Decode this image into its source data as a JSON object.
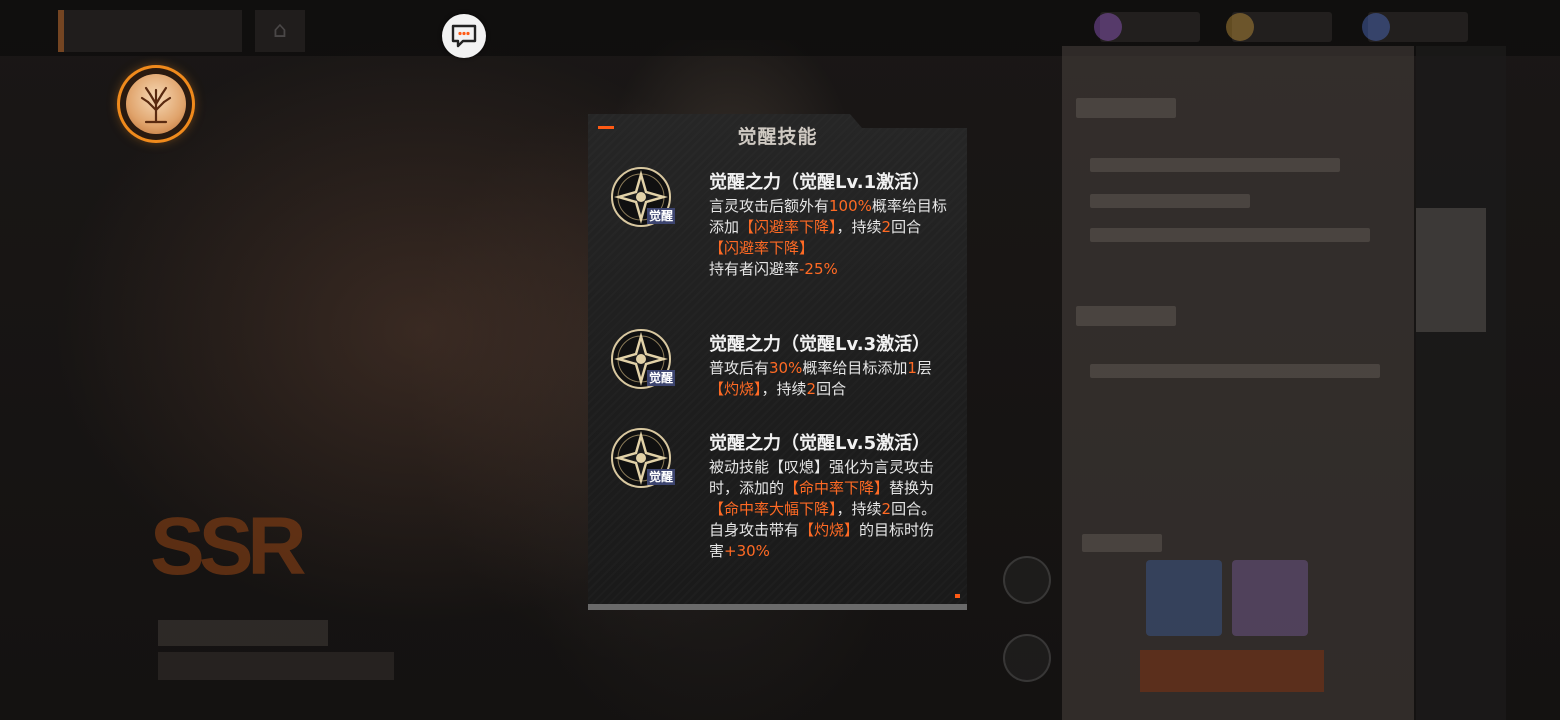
{
  "popup": {
    "title": "觉醒技能",
    "skills": [
      {
        "badge": "觉醒",
        "name": "觉醒之力（觉醒Lv.1激活）",
        "desc": [
          {
            "t": "言灵攻击后额外有",
            "h": false
          },
          {
            "t": "100%",
            "h": true
          },
          {
            "t": "概率给目标添加",
            "h": false
          },
          {
            "t": "【闪避率下降】",
            "h": true
          },
          {
            "t": "，持续",
            "h": false
          },
          {
            "t": "2",
            "h": true
          },
          {
            "t": "回合",
            "h": false
          },
          {
            "t": "\n",
            "h": false
          },
          {
            "t": "【闪避率下降】",
            "h": true
          },
          {
            "t": "\n",
            "h": false
          },
          {
            "t": "持有者闪避率",
            "h": false
          },
          {
            "t": "-25%",
            "h": true
          }
        ]
      },
      {
        "badge": "觉醒",
        "name": "觉醒之力（觉醒Lv.3激活）",
        "desc": [
          {
            "t": "普攻后有",
            "h": false
          },
          {
            "t": "30%",
            "h": true
          },
          {
            "t": "概率给目标添加",
            "h": false
          },
          {
            "t": "1",
            "h": true
          },
          {
            "t": "层",
            "h": false
          },
          {
            "t": "【灼烧】",
            "h": true
          },
          {
            "t": "，持续",
            "h": false
          },
          {
            "t": "2",
            "h": true
          },
          {
            "t": "回合",
            "h": false
          }
        ]
      },
      {
        "badge": "觉醒",
        "name": "觉醒之力（觉醒Lv.5激活）",
        "desc": [
          {
            "t": "被动技能【叹熄】强化为言灵攻击时，添加的",
            "h": false
          },
          {
            "t": "【命中率下降】",
            "h": true
          },
          {
            "t": "替换为",
            "h": false
          },
          {
            "t": "【命中率大幅下降】",
            "h": true
          },
          {
            "t": "，持续",
            "h": false
          },
          {
            "t": "2",
            "h": true
          },
          {
            "t": "回合。自身攻击带有",
            "h": false
          },
          {
            "t": "【灼烧】",
            "h": true
          },
          {
            "t": "的目标时伤害",
            "h": false
          },
          {
            "t": "+30%",
            "h": true
          }
        ]
      }
    ]
  },
  "buttons": {
    "chat_icon": "chat-bubble-icon",
    "tree_icon": "tree-icon"
  },
  "background": {
    "rarity": "SSR"
  },
  "colors": {
    "highlight": "#ff6a24",
    "accent": "#ff5a14",
    "tree_ring": "#f08a1c",
    "badge_bg": "#3d4570"
  }
}
